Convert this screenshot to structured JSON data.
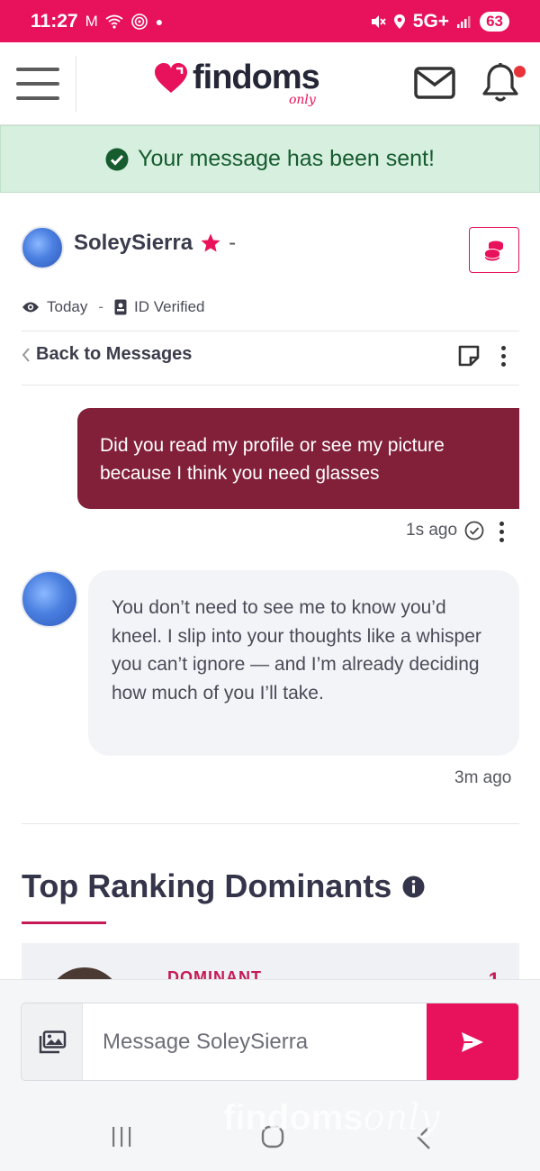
{
  "status_bar": {
    "time": "11:27",
    "network": "5G+",
    "battery": "63",
    "icons": [
      "gmail-icon",
      "wifi-icon",
      "hotspot-icon",
      "dot-icon",
      "mute-icon",
      "location-icon",
      "signal-icon",
      "battery-icon"
    ]
  },
  "header": {
    "logo_text": "findoms",
    "logo_suffix": "only",
    "menu_icon": "hamburger-menu-icon",
    "mail_icon": "envelope-icon",
    "notifications_icon": "bell-icon",
    "notification_dot_color": "#e8333b"
  },
  "alert": {
    "text": "Your message has been sent!",
    "icon": "check-circle-icon",
    "bg_color": "#d6efdf",
    "text_color": "#165c2e"
  },
  "profile": {
    "name": "SoleySierra",
    "badge_icon": "star-icon",
    "suffix": "-",
    "last_seen": "Today",
    "separator": "-",
    "verification": "ID Verified",
    "tip_icon": "coins-icon"
  },
  "conversation_nav": {
    "back_label": "Back to Messages",
    "note_icon": "sticky-note-icon",
    "options_icon": "more-vertical-icon"
  },
  "messages": [
    {
      "direction": "sent",
      "text": "Did you read my profile or see my picture because I think you need glasses",
      "time": "1s ago",
      "status_icon": "check-circle-icon"
    },
    {
      "direction": "received",
      "text": "You don’t need to see me to know you’d kneel. I slip into your thoughts like a whisper you can’t ignore — and I’m already deciding how much of you I’ll take.",
      "time": "3m ago"
    }
  ],
  "ranking": {
    "title": "Top Ranking Dominants",
    "info_icon": "info-circle-icon",
    "first_card": {
      "label": "DOMINANT",
      "rank": "1"
    }
  },
  "composer": {
    "placeholder": "Message SoleySierra",
    "attach_icon": "image-gallery-icon",
    "send_icon": "send-icon"
  },
  "system_nav": {
    "recents_icon": "recents-icon",
    "home_icon": "home-icon",
    "back_icon": "back-icon"
  },
  "colors": {
    "brand": "#e8115b",
    "sent_bubble": "#82203a",
    "received_bubble": "#f3f4f7"
  }
}
